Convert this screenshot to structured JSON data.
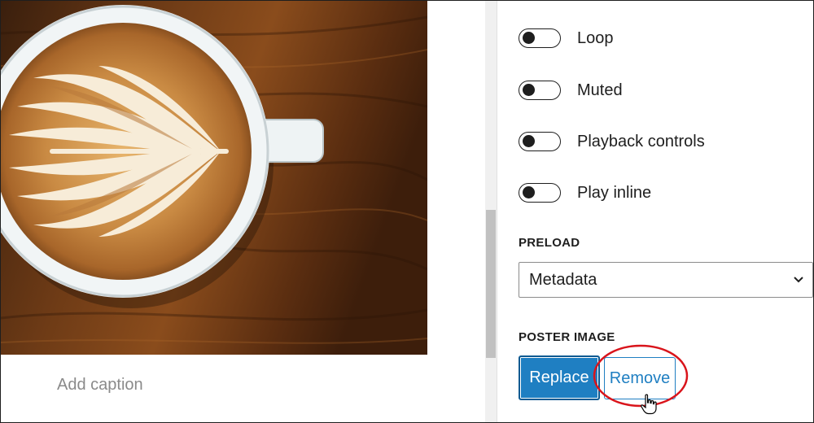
{
  "canvas": {
    "caption_placeholder": "Add caption",
    "poster_image": "latte-art-coffee-cup-photo"
  },
  "sidebar": {
    "toggles": [
      {
        "label": "Loop",
        "checked": false
      },
      {
        "label": "Muted",
        "checked": false
      },
      {
        "label": "Playback controls",
        "checked": false
      },
      {
        "label": "Play inline",
        "checked": false
      }
    ],
    "preload": {
      "label": "PRELOAD",
      "value": "Metadata"
    },
    "poster": {
      "label": "POSTER IMAGE",
      "replace_label": "Replace",
      "remove_label": "Remove"
    }
  },
  "colors": {
    "accent": "#1f7fc2",
    "highlight_ring": "#d9141b"
  },
  "icons": {
    "select": "chevron-down-icon",
    "pointer": "hand-cursor-icon"
  }
}
